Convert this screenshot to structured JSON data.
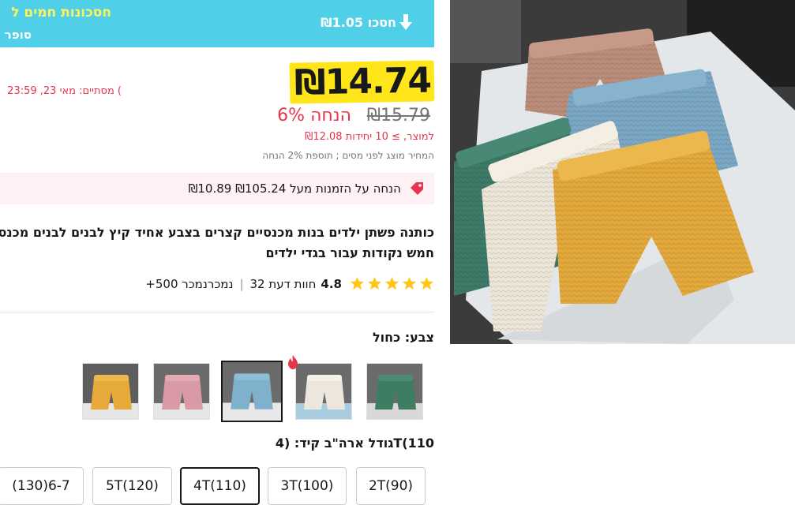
{
  "promo": {
    "title": "חסכונות חמים ל",
    "subtitle": "סופר",
    "savings": "₪1.05 חסכו"
  },
  "price": {
    "current": "₪14.74",
    "original": "₪15.79",
    "discount": "6% הנחה",
    "end_label": "מסתיים:  מאי 23, 23:59 (",
    "tier": "₪12.08 למוצר, ≥ 10 יחידות",
    "tax_note": "המחיר מוצג לפני מסים ; תוספת 2% הנחה"
  },
  "coupon": {
    "text": "₪10.89 הנחה על הזמנות מעל ₪105.24"
  },
  "product": {
    "title_line1": "כותנה פשתן ילדים בנות מכנסיים קצרים בצבע אחיד קיץ לבנים לבנים מכנס",
    "title_line2": "חמש נקודות עבור בגדי ילדים"
  },
  "rating": {
    "value": "4.8",
    "reviews": "32 חוות דעת",
    "sold": "+500  נמכרנמכר",
    "stars": 5
  },
  "color": {
    "label": "צבע: כחול",
    "swatches": [
      {
        "name": "green",
        "color": "#3f7d63",
        "selected": false
      },
      {
        "name": "white",
        "color": "#ece6dc",
        "selected": false
      },
      {
        "name": "blue",
        "color": "#7fb0cc",
        "selected": true
      },
      {
        "name": "pink",
        "color": "#d99aa6",
        "selected": false
      },
      {
        "name": "yellow",
        "color": "#e6a93a",
        "selected": false
      }
    ]
  },
  "size": {
    "label": "גודל ארה\"ב קיד: (4T(110",
    "options": [
      "2T(90)",
      "3T(100)",
      "4T(110)",
      "5T(120)",
      "(130)6-7"
    ],
    "selected": "4T(110)"
  },
  "colors": {
    "banner": "#4fd0e8",
    "promo_yellow": "#fff45c",
    "price_highlight": "#ffe61a",
    "sale_red": "#e8344e",
    "coupon_bg": "#fff1f3",
    "star": "#ffc617"
  }
}
